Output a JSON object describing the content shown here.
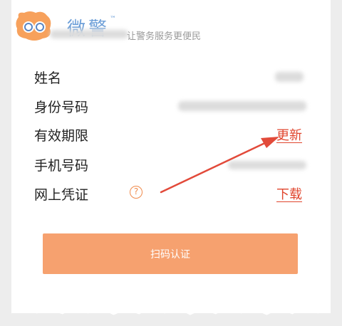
{
  "header": {
    "brand": "微警",
    "trademark": "™",
    "slogan": "让警务服务更便民"
  },
  "rows": [
    {
      "label": "姓名"
    },
    {
      "label": "身份号码"
    },
    {
      "label": "有效期限",
      "action": "更新"
    },
    {
      "label": "手机号码"
    },
    {
      "label": "网上凭证",
      "action": "下载"
    }
  ],
  "help_icon_glyph": "?",
  "scan_button": "扫码认证",
  "colors": {
    "accent_red": "#e0462e",
    "button_orange": "#f6a16f",
    "brand_blue": "#6d9fd8",
    "logo_orange": "#f7a15c"
  },
  "icons": [
    "logo-icon",
    "help-icon",
    "arrow-annotation"
  ]
}
